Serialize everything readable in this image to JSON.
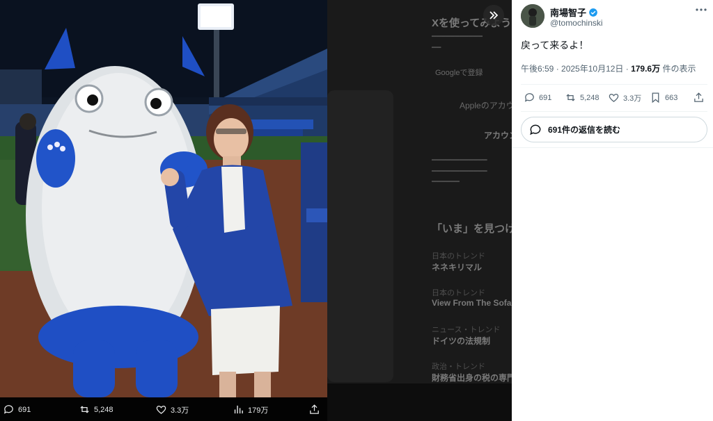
{
  "media": {
    "actions": {
      "replies": "691",
      "reposts": "5,248",
      "likes": "3.3万",
      "views": "179万"
    }
  },
  "background_timeline": {
    "heading": "Xを使ってみよう",
    "signup_google": "Googleで登録",
    "signup_apple": "Appleのアカウントで登録",
    "create_account": "アカウントを作成",
    "trends_heading": "「いま」を見つけよう",
    "trends": [
      {
        "context": "日本のトレンド",
        "name": "ネネキリマル"
      },
      {
        "context": "日本のトレンド",
        "name": "View From The Sofa"
      },
      {
        "context": "ニュース・トレンド",
        "name": "ドイツの法規制"
      },
      {
        "context": "政治・トレンド",
        "name": "財務省出身の税の専門家"
      }
    ]
  },
  "tweet": {
    "author_name": "南場智子",
    "author_handle": "@tomochinski",
    "text": "戻って来るよ！",
    "timestamp": "午後6:59 · 2025年10月12日 · ",
    "views_count": "179.6万",
    "views_label": " 件の表示",
    "actions": {
      "replies": "691",
      "reposts": "5,248",
      "likes": "3.3万",
      "bookmarks": "663"
    },
    "read_replies": "691件の返信を読む"
  },
  "colors": {
    "verified": "#1d9bf0",
    "text_primary": "#0f1419",
    "text_secondary": "#536471",
    "mascot_blue": "#1f4fc4",
    "jacket_blue": "#2346a8"
  }
}
